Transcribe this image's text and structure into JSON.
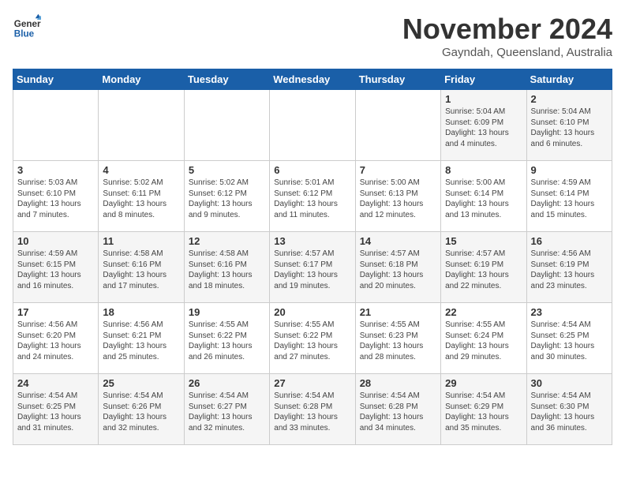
{
  "logo": {
    "line1": "General",
    "line2": "Blue"
  },
  "title": "November 2024",
  "subtitle": "Gayndah, Queensland, Australia",
  "days_of_week": [
    "Sunday",
    "Monday",
    "Tuesday",
    "Wednesday",
    "Thursday",
    "Friday",
    "Saturday"
  ],
  "weeks": [
    [
      {
        "day": "",
        "info": ""
      },
      {
        "day": "",
        "info": ""
      },
      {
        "day": "",
        "info": ""
      },
      {
        "day": "",
        "info": ""
      },
      {
        "day": "",
        "info": ""
      },
      {
        "day": "1",
        "info": "Sunrise: 5:04 AM\nSunset: 6:09 PM\nDaylight: 13 hours and 4 minutes."
      },
      {
        "day": "2",
        "info": "Sunrise: 5:04 AM\nSunset: 6:10 PM\nDaylight: 13 hours and 6 minutes."
      }
    ],
    [
      {
        "day": "3",
        "info": "Sunrise: 5:03 AM\nSunset: 6:10 PM\nDaylight: 13 hours and 7 minutes."
      },
      {
        "day": "4",
        "info": "Sunrise: 5:02 AM\nSunset: 6:11 PM\nDaylight: 13 hours and 8 minutes."
      },
      {
        "day": "5",
        "info": "Sunrise: 5:02 AM\nSunset: 6:12 PM\nDaylight: 13 hours and 9 minutes."
      },
      {
        "day": "6",
        "info": "Sunrise: 5:01 AM\nSunset: 6:12 PM\nDaylight: 13 hours and 11 minutes."
      },
      {
        "day": "7",
        "info": "Sunrise: 5:00 AM\nSunset: 6:13 PM\nDaylight: 13 hours and 12 minutes."
      },
      {
        "day": "8",
        "info": "Sunrise: 5:00 AM\nSunset: 6:14 PM\nDaylight: 13 hours and 13 minutes."
      },
      {
        "day": "9",
        "info": "Sunrise: 4:59 AM\nSunset: 6:14 PM\nDaylight: 13 hours and 15 minutes."
      }
    ],
    [
      {
        "day": "10",
        "info": "Sunrise: 4:59 AM\nSunset: 6:15 PM\nDaylight: 13 hours and 16 minutes."
      },
      {
        "day": "11",
        "info": "Sunrise: 4:58 AM\nSunset: 6:16 PM\nDaylight: 13 hours and 17 minutes."
      },
      {
        "day": "12",
        "info": "Sunrise: 4:58 AM\nSunset: 6:16 PM\nDaylight: 13 hours and 18 minutes."
      },
      {
        "day": "13",
        "info": "Sunrise: 4:57 AM\nSunset: 6:17 PM\nDaylight: 13 hours and 19 minutes."
      },
      {
        "day": "14",
        "info": "Sunrise: 4:57 AM\nSunset: 6:18 PM\nDaylight: 13 hours and 20 minutes."
      },
      {
        "day": "15",
        "info": "Sunrise: 4:57 AM\nSunset: 6:19 PM\nDaylight: 13 hours and 22 minutes."
      },
      {
        "day": "16",
        "info": "Sunrise: 4:56 AM\nSunset: 6:19 PM\nDaylight: 13 hours and 23 minutes."
      }
    ],
    [
      {
        "day": "17",
        "info": "Sunrise: 4:56 AM\nSunset: 6:20 PM\nDaylight: 13 hours and 24 minutes."
      },
      {
        "day": "18",
        "info": "Sunrise: 4:56 AM\nSunset: 6:21 PM\nDaylight: 13 hours and 25 minutes."
      },
      {
        "day": "19",
        "info": "Sunrise: 4:55 AM\nSunset: 6:22 PM\nDaylight: 13 hours and 26 minutes."
      },
      {
        "day": "20",
        "info": "Sunrise: 4:55 AM\nSunset: 6:22 PM\nDaylight: 13 hours and 27 minutes."
      },
      {
        "day": "21",
        "info": "Sunrise: 4:55 AM\nSunset: 6:23 PM\nDaylight: 13 hours and 28 minutes."
      },
      {
        "day": "22",
        "info": "Sunrise: 4:55 AM\nSunset: 6:24 PM\nDaylight: 13 hours and 29 minutes."
      },
      {
        "day": "23",
        "info": "Sunrise: 4:54 AM\nSunset: 6:25 PM\nDaylight: 13 hours and 30 minutes."
      }
    ],
    [
      {
        "day": "24",
        "info": "Sunrise: 4:54 AM\nSunset: 6:25 PM\nDaylight: 13 hours and 31 minutes."
      },
      {
        "day": "25",
        "info": "Sunrise: 4:54 AM\nSunset: 6:26 PM\nDaylight: 13 hours and 32 minutes."
      },
      {
        "day": "26",
        "info": "Sunrise: 4:54 AM\nSunset: 6:27 PM\nDaylight: 13 hours and 32 minutes."
      },
      {
        "day": "27",
        "info": "Sunrise: 4:54 AM\nSunset: 6:28 PM\nDaylight: 13 hours and 33 minutes."
      },
      {
        "day": "28",
        "info": "Sunrise: 4:54 AM\nSunset: 6:28 PM\nDaylight: 13 hours and 34 minutes."
      },
      {
        "day": "29",
        "info": "Sunrise: 4:54 AM\nSunset: 6:29 PM\nDaylight: 13 hours and 35 minutes."
      },
      {
        "day": "30",
        "info": "Sunrise: 4:54 AM\nSunset: 6:30 PM\nDaylight: 13 hours and 36 minutes."
      }
    ]
  ]
}
